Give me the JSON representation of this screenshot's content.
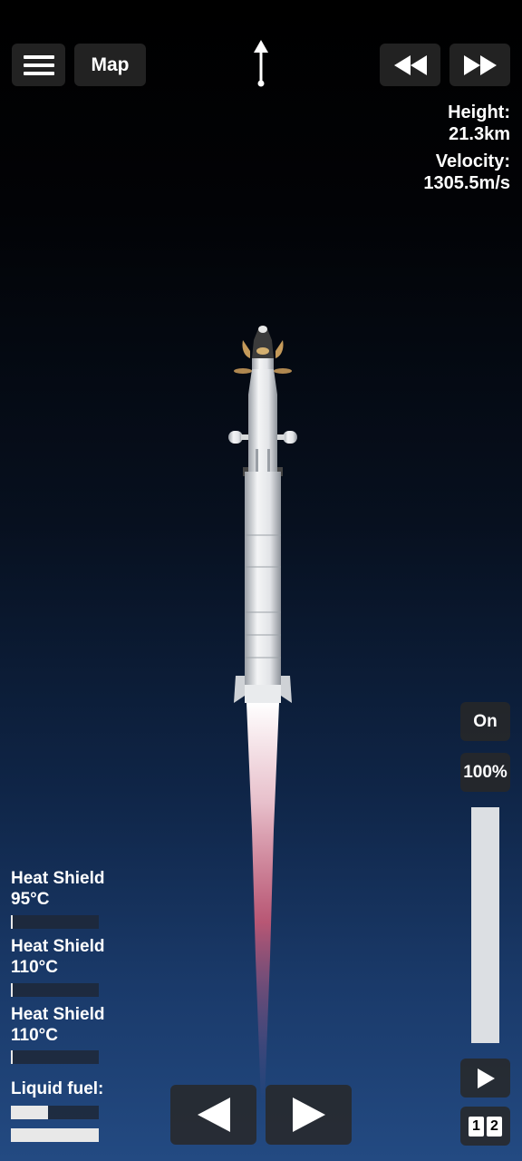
{
  "top_bar": {
    "menu_icon": "hamburger-menu-icon",
    "map_label": "Map",
    "heading_icon": "heading-arrow-icon",
    "rewind_icon": "rewind-icon",
    "fast_forward_icon": "fast-forward-icon"
  },
  "telemetry": {
    "height_label": "Height:",
    "height_value": "21.3km",
    "velocity_label": "Velocity:",
    "velocity_value": "1305.5m/s"
  },
  "engine": {
    "on_label": "On",
    "throttle_label": "100%",
    "throttle_fraction": 1.0
  },
  "gauges": [
    {
      "name": "Heat Shield",
      "value": "95°C",
      "fraction": 0.0
    },
    {
      "name": "Heat Shield",
      "value": "110°C",
      "fraction": 0.0
    },
    {
      "name": "Heat Shield",
      "value": "110°C",
      "fraction": 0.0
    }
  ],
  "fuel": {
    "label": "Liquid fuel:",
    "stage_fraction": 0.42,
    "total_fraction": 1.0
  },
  "controls": {
    "rotate_left_icon": "rotate-left-icon",
    "rotate_right_icon": "rotate-right-icon",
    "play_icon": "play-icon",
    "stages": [
      "1",
      "2"
    ]
  },
  "colors": {
    "panel": "#282828",
    "throttle_fill": "#dcdfe3",
    "exhaust": "#e0607a"
  }
}
